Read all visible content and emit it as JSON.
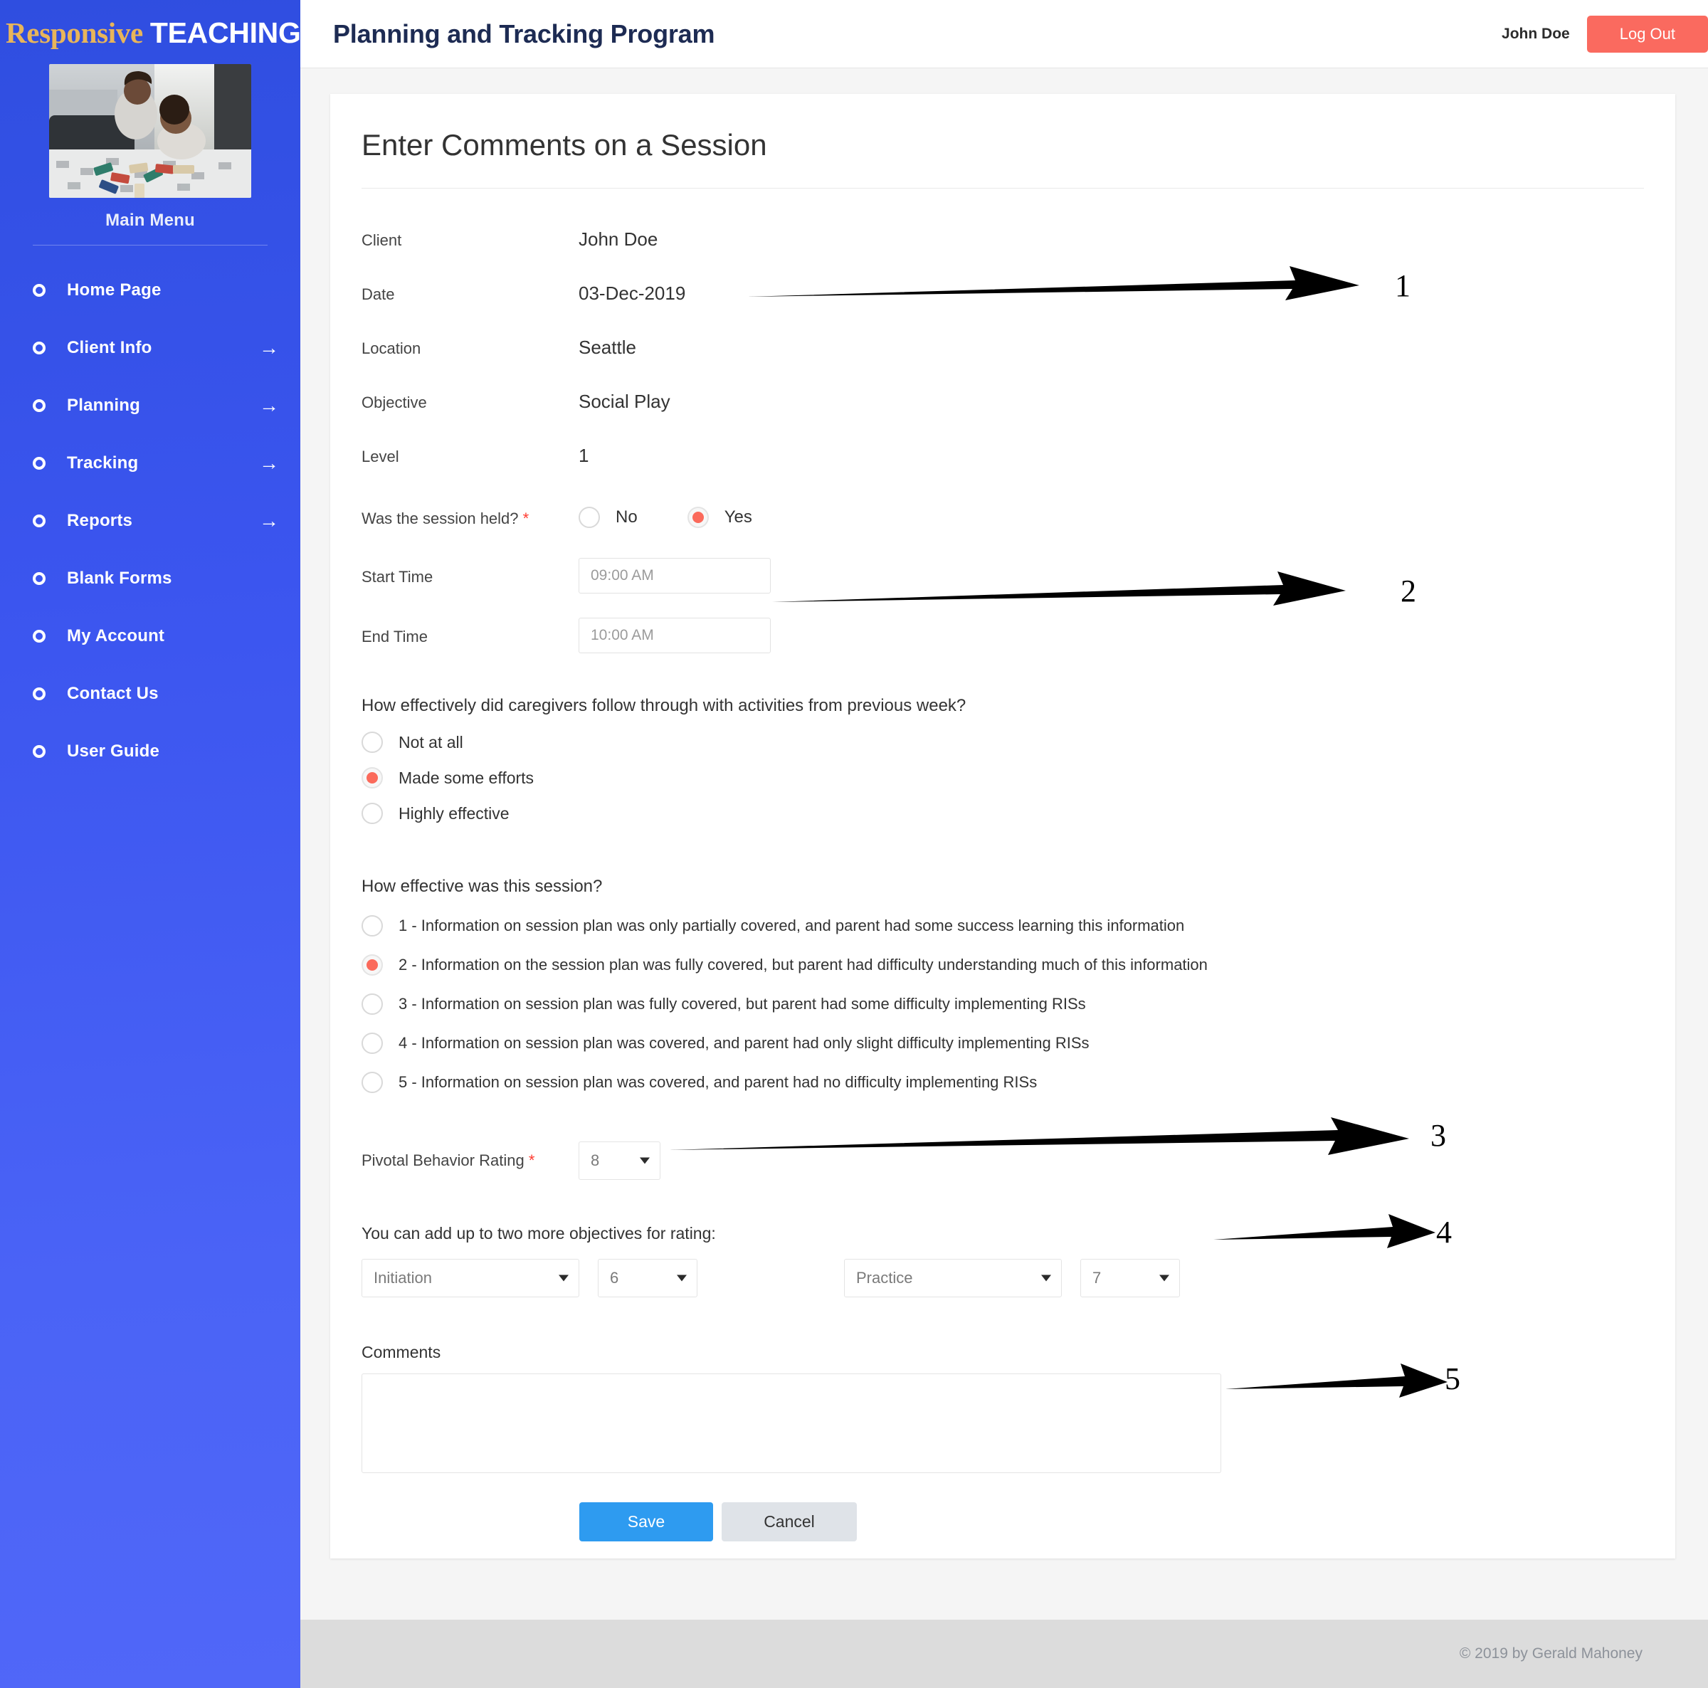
{
  "sidebar": {
    "brand_first": "Responsive",
    "brand_second": "TEACHING",
    "photo_alt": "caregiver-and-child-playing-with-blocks",
    "main_menu_label": "Main Menu",
    "items": [
      {
        "label": "Home Page",
        "arrow": ""
      },
      {
        "label": "Client Info",
        "arrow": "→"
      },
      {
        "label": "Planning",
        "arrow": "→"
      },
      {
        "label": "Tracking",
        "arrow": "→"
      },
      {
        "label": "Reports",
        "arrow": "→"
      },
      {
        "label": "Blank Forms",
        "arrow": ""
      },
      {
        "label": "My Account",
        "arrow": ""
      },
      {
        "label": "Contact Us",
        "arrow": ""
      },
      {
        "label": "User Guide",
        "arrow": ""
      }
    ]
  },
  "header": {
    "title": "Planning and Tracking Program",
    "user_name": "John Doe",
    "logout_label": "Log Out"
  },
  "main": {
    "card_title": "Enter Comments on a Session",
    "fields": {
      "client_label": "Client",
      "client_value": "John Doe",
      "date_label": "Date",
      "date_value": "03-Dec-2019",
      "location_label": "Location",
      "location_value": "Seattle",
      "objective_label": "Objective",
      "objective_value": "Social Play",
      "level_label": "Level",
      "level_value": "1"
    },
    "session_held": {
      "label": "Was the session held?",
      "required_marker": "*",
      "options": [
        {
          "label": "No",
          "selected": false
        },
        {
          "label": "Yes",
          "selected": true
        }
      ]
    },
    "start_time": {
      "label": "Start Time",
      "value": "09:00 AM"
    },
    "end_time": {
      "label": "End Time",
      "value": "10:00 AM"
    },
    "followthrough": {
      "question": "How effectively did caregivers follow through with activities from previous week?",
      "options": [
        {
          "label": "Not at all",
          "selected": false
        },
        {
          "label": "Made some efforts",
          "selected": true
        },
        {
          "label": "Highly effective",
          "selected": false
        }
      ]
    },
    "effectiveness": {
      "question": "How effective was this session?",
      "options": [
        {
          "label": "1 - Information on session plan was only partially covered, and parent had some success learning this information",
          "selected": false
        },
        {
          "label": "2 - Information on the session plan was fully covered, but parent had difficulty understanding much of this information",
          "selected": true
        },
        {
          "label": "3 - Information on session plan was fully covered, but parent had some difficulty implementing RISs",
          "selected": false
        },
        {
          "label": "4 - Information on session plan was covered, and parent had only slight difficulty implementing RISs",
          "selected": false
        },
        {
          "label": "5 - Information on session plan was covered, and parent had no difficulty implementing RISs",
          "selected": false
        }
      ]
    },
    "pivotal": {
      "label": "Pivotal Behavior Rating",
      "required_marker": "*",
      "value": "8"
    },
    "extra_objectives": {
      "note": "You can add up to two more objectives for rating:",
      "objective_1": "Initiation",
      "rating_1": "6",
      "objective_2": "Practice",
      "rating_2": "7"
    },
    "comments": {
      "label": "Comments",
      "value": "",
      "placeholder": ""
    },
    "buttons": {
      "save": "Save",
      "cancel": "Cancel"
    }
  },
  "footer": {
    "copyright": "© 2019 by Gerald Mahoney"
  },
  "annotations": [
    {
      "number": "1"
    },
    {
      "number": "2"
    },
    {
      "number": "3"
    },
    {
      "number": "4"
    },
    {
      "number": "5"
    }
  ]
}
